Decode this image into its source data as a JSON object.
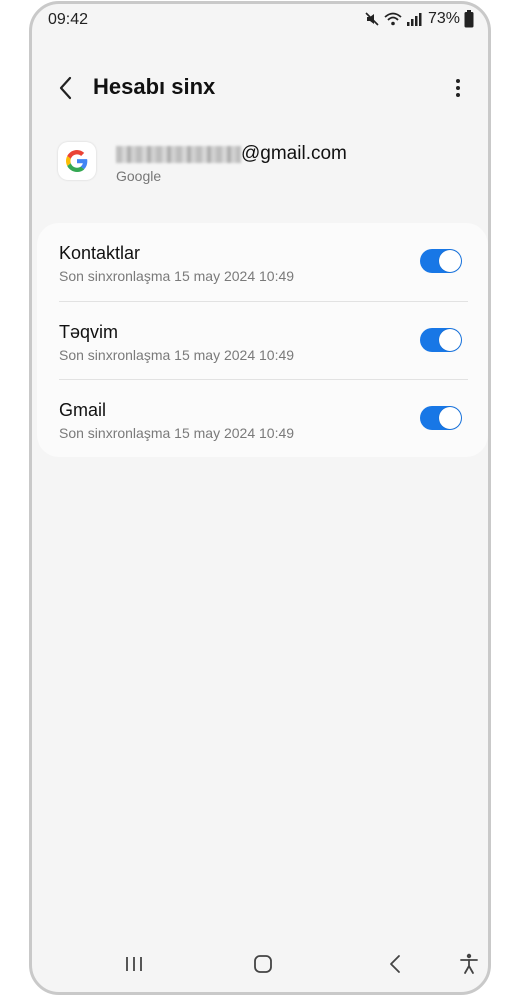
{
  "status": {
    "time": "09:42",
    "battery": "73%",
    "icons": [
      "mute-icon",
      "wifi-icon",
      "signal-icon",
      "battery-icon"
    ]
  },
  "appbar": {
    "title": "Hesabı sinx",
    "back_icon": "back-arrow-icon",
    "more_icon": "more-vertical-icon"
  },
  "account": {
    "email_suffix": "@gmail.com",
    "provider": "Google",
    "logo_icon": "google-logo-icon"
  },
  "sync_items": [
    {
      "name": "Kontaktlar",
      "last_sync": "Son sinxronlaşma 15 may 2024 10:49",
      "enabled": true
    },
    {
      "name": "Təqvim",
      "last_sync": "Son sinxronlaşma 15 may 2024 10:49",
      "enabled": true
    },
    {
      "name": "Gmail",
      "last_sync": "Son sinxronlaşma 15 may 2024 10:49",
      "enabled": true
    }
  ],
  "colors": {
    "accent": "#1877e6",
    "background": "#f5f5f5",
    "card": "#fbfbfb"
  },
  "navbar": {
    "icons": [
      "recents-icon",
      "home-icon",
      "back-icon",
      "accessibility-icon"
    ]
  }
}
